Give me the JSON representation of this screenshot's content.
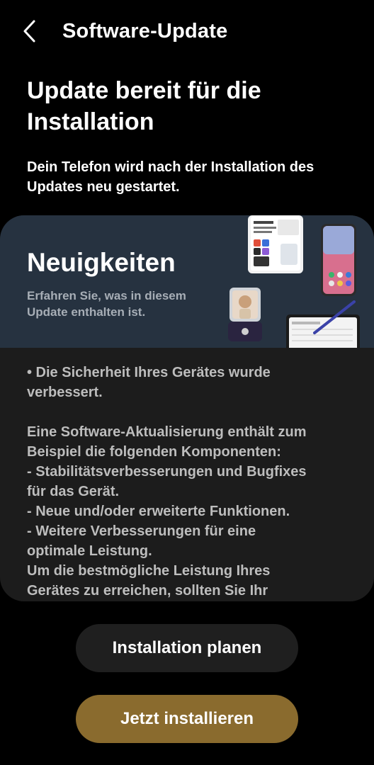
{
  "header": {
    "title": "Software-Update",
    "back_icon": "chevron-left-icon"
  },
  "main": {
    "headline": "Update bereit für die Installation",
    "subtitle": "Dein Telefon wird nach der Installation des Updates neu gestartet."
  },
  "whats_new": {
    "title": "Neuigkeiten",
    "subtitle": "Erfahren Sie, was in diesem Update enthalten ist.",
    "notes": [
      "• Die Sicherheit Ihres Gerätes wurde",
      "verbessert.",
      "",
      "Eine Software-Aktualisierung enthält zum",
      "Beispiel die folgenden Komponenten:",
      " - Stabilitätsverbesserungen und Bugfixes",
      "für das Gerät.",
      " - Neue und/oder erweiterte Funktionen.",
      " - Weitere Verbesserungen für eine",
      "optimale Leistung.",
      "Um die bestmögliche Leistung Ihres",
      "Gerätes zu erreichen, sollten Sie Ihr"
    ]
  },
  "buttons": {
    "schedule_label": "Installation planen",
    "install_label": "Jetzt installieren"
  },
  "colors": {
    "background": "#000000",
    "card": "#1c1c1c",
    "hero": "#263240",
    "install_button": "#8a6b2e",
    "schedule_button": "#1f1f1f"
  }
}
